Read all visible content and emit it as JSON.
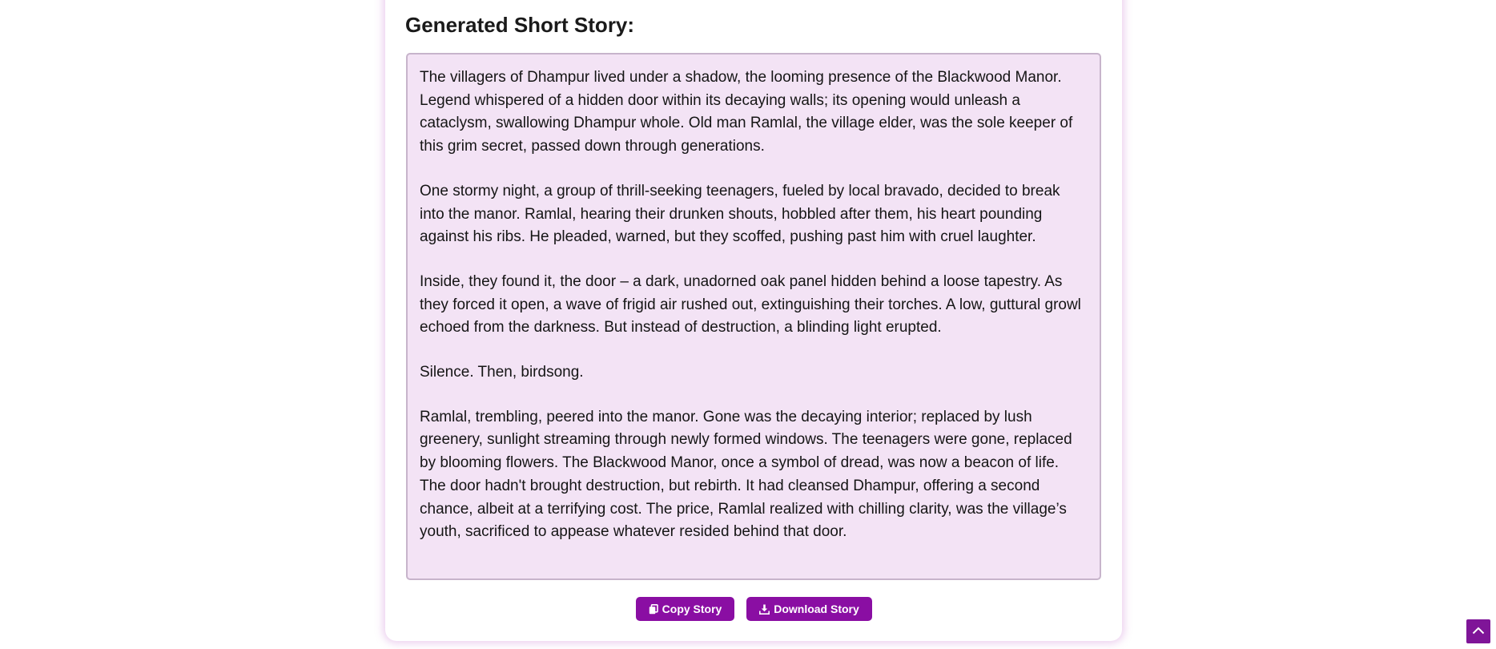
{
  "page": {
    "title": "Generated Short Story:"
  },
  "story": {
    "paragraphs": [
      "The villagers of Dhampur lived under a shadow, the looming presence of the Blackwood Manor. Legend whispered of a hidden door within its decaying walls; its opening would unleash a cataclysm, swallowing Dhampur whole. Old man Ramlal, the village elder, was the sole keeper of this grim secret, passed down through generations.",
      "One stormy night, a group of thrill-seeking teenagers, fueled by local bravado, decided to break into the manor. Ramlal, hearing their drunken shouts, hobbled after them, his heart pounding against his ribs. He pleaded, warned, but they scoffed, pushing past him with cruel laughter.",
      "Inside, they found it, the door – a dark, unadorned oak panel hidden behind a loose tapestry. As they forced it open, a wave of frigid air rushed out, extinguishing their torches. A low, guttural growl echoed from the darkness. But instead of destruction, a blinding light erupted.",
      "Silence. Then, birdsong.",
      "Ramlal, trembling, peered into the manor. Gone was the decaying interior; replaced by lush greenery, sunlight streaming through newly formed windows. The teenagers were gone, replaced by blooming flowers. The Blackwood Manor, once a symbol of dread, was now a beacon of life. The door hadn't brought destruction, but rebirth. It had cleansed Dhampur, offering a second chance, albeit at a terrifying cost. The price, Ramlal realized with chilling clarity, was the village’s youth, sacrificed to appease whatever resided behind that door."
    ]
  },
  "actions": {
    "copy_label": "Copy Story",
    "copy_icon": "copy-icon",
    "download_label": "Download Story",
    "download_icon": "download-icon",
    "scroll_top_icon": "chevron-up-icon"
  },
  "colors": {
    "accent": "#8a0ea3",
    "story_background": "#f3e3f5",
    "scroll_top_background": "#7f1598"
  }
}
